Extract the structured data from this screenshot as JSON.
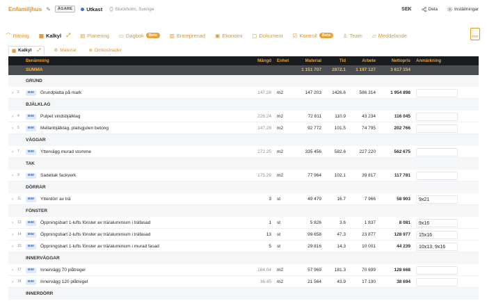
{
  "header": {
    "title": "Enfamiljhus",
    "role_badge": "ÄGARE",
    "status": "Utkast",
    "location": "Stockholm, Sverige",
    "currency": "SEK",
    "share_label": "Dela",
    "settings_label": "Inställningar"
  },
  "tabs": [
    {
      "label": "Ritning",
      "icon": "ruler-icon"
    },
    {
      "label": "Kalkyl",
      "icon": "calculator-icon",
      "active": true
    },
    {
      "label": "Planering",
      "icon": "calendar-icon"
    },
    {
      "label": "Dagbok",
      "icon": "book-icon",
      "badge": "Beta"
    },
    {
      "label": "Entreprenad",
      "icon": "building-icon"
    },
    {
      "label": "Ekonomi",
      "icon": "wallet-icon"
    },
    {
      "label": "Dokument",
      "icon": "folder-icon"
    },
    {
      "label": "Kontroll",
      "icon": "checklist-icon",
      "badge": "Beta"
    },
    {
      "label": "Team",
      "icon": "team-icon"
    },
    {
      "label": "Meddelande",
      "icon": "chat-icon"
    }
  ],
  "doc_button": "PDF",
  "subtabs": [
    {
      "label": "Kalkyl",
      "active": true
    },
    {
      "label": "Material"
    },
    {
      "label": "Omkostnader"
    }
  ],
  "columns": {
    "name": "Benämning",
    "qty": "Mängd",
    "unit": "Enhet",
    "material": "Material",
    "time": "Tid",
    "work": "Arbete",
    "net": "Nettopris",
    "note": "Anmärkning"
  },
  "summary": {
    "label": "SUMMA",
    "material": "1 151 707",
    "time": "2872.1",
    "work": "1 197 127",
    "net": "3 617 154"
  },
  "bim_label": "BIM",
  "groups": [
    {
      "name": "GRUND",
      "items": [
        {
          "num": "2",
          "name": "Grundplatta på mark",
          "qty": "147.28",
          "unit": "m2",
          "material": "147 203",
          "time": "1426.6",
          "work": "586 314",
          "net": "1 954 898",
          "note": ""
        }
      ]
    },
    {
      "name": "BJÄLKLAG",
      "items": [
        {
          "num": "4",
          "name": "Pulpet vindsbjälklag",
          "qty": "226.24",
          "unit": "m2",
          "material": "72 811",
          "time": "110.9",
          "work": "43 234",
          "net": "116 045",
          "note": ""
        },
        {
          "num": "5",
          "name": "Mellanbjälklag, platsgjuten betong",
          "qty": "147.28",
          "unit": "m2",
          "material": "92 772",
          "time": "101.5",
          "work": "74 795",
          "net": "202 766",
          "note": ""
        }
      ]
    },
    {
      "name": "VÄGGAR",
      "items": [
        {
          "num": "7",
          "name": "Yttervägg murad stomme",
          "qty": "272.25",
          "unit": "m2",
          "material": "335 456",
          "time": "582.6",
          "work": "227 220",
          "net": "562 675",
          "note": ""
        }
      ]
    },
    {
      "name": "TAK",
      "items": [
        {
          "num": "9",
          "name": "Sadeltak fackverk",
          "qty": "175.29",
          "unit": "m2",
          "material": "77 964",
          "time": "102.1",
          "work": "39 817",
          "net": "117 781",
          "note": ""
        }
      ]
    },
    {
      "name": "DÖRRAR",
      "items": [
        {
          "num": "11",
          "name": "Ytterdörr av trä",
          "qty": "3",
          "unit": "st",
          "material": "49 479",
          "time": "16.7",
          "work": "7 966",
          "net": "58 903",
          "note": "9x21",
          "qty_dark": true
        }
      ]
    },
    {
      "name": "FÖNSTER",
      "items": [
        {
          "num": "13",
          "name": "Öppningsbart 1-lufts fönster av trä/aluminium i träfasad",
          "qty": "1",
          "unit": "st",
          "material": "5 826",
          "time": "3.6",
          "work": "1 837",
          "net": "8 081",
          "note": "9x16",
          "qty_dark": true
        },
        {
          "num": "14",
          "name": "Öppningsbart 2-lufts fönster av trä/aluminium i träfasad",
          "qty": "13",
          "unit": "st",
          "material": "99 658",
          "time": "47.3",
          "work": "23 877",
          "net": "128 977",
          "note": "15x16",
          "qty_dark": true
        },
        {
          "num": "15",
          "name": "Öppningsbart 1-lufts fönster av trä/aluminium i murad fasad",
          "qty": "5",
          "unit": "st",
          "material": "29 816",
          "time": "14.3",
          "work": "10 001",
          "net": "44 239",
          "note": "10x13, 9x16",
          "qty_dark": true
        }
      ]
    },
    {
      "name": "INNERVÄGGAR",
      "items": [
        {
          "num": "17",
          "name": "Innervägg 70 plåtregel",
          "qty": "184.04",
          "unit": "m2",
          "material": "57 969",
          "time": "181.3",
          "work": "70 699",
          "net": "128 668",
          "note": ""
        },
        {
          "num": "18",
          "name": "Innervägg 120 plåtregel",
          "qty": "36.45",
          "unit": "m2",
          "material": "21 564",
          "time": "43.9",
          "work": "17 130",
          "net": "38 694",
          "note": ""
        }
      ]
    },
    {
      "name": "INNERDÖRR",
      "items": []
    }
  ]
}
